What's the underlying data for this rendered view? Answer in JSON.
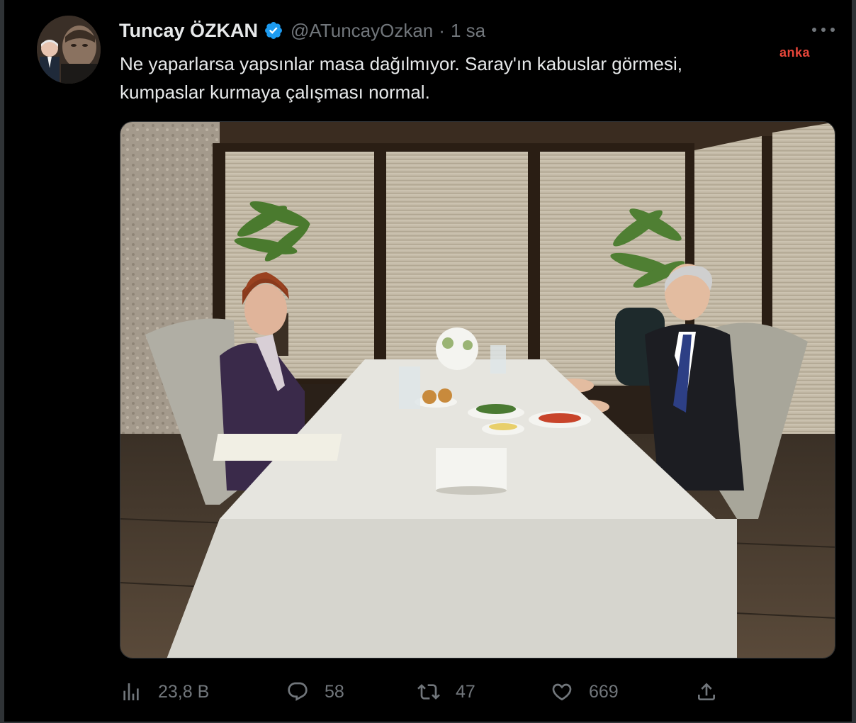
{
  "tweet": {
    "author_name": "Tuncay ÖZKAN",
    "handle": "@ATuncayOzkan",
    "separator": "·",
    "time": "1 sa",
    "text": "Ne yaparlarsa yapsınlar masa dağılmıyor. Saray'ın kabuslar görmesi, kumpaslar kurmaya çalışması normal.",
    "media_icon": "photo",
    "verified_icon": "verified-badge-icon"
  },
  "watermark": "anka",
  "actions": {
    "views": {
      "icon": "views-icon",
      "count": "23,8 B"
    },
    "reply": {
      "icon": "reply-icon",
      "count": "58"
    },
    "retweet": {
      "icon": "retweet-icon",
      "count": "47"
    },
    "like": {
      "icon": "like-icon",
      "count": "669"
    },
    "share": {
      "icon": "share-icon"
    }
  },
  "colors": {
    "background": "#000000",
    "text_primary": "#e7e9ea",
    "text_secondary": "#71767b",
    "verified": "#1d9bf0",
    "watermark": "#e8463a"
  }
}
